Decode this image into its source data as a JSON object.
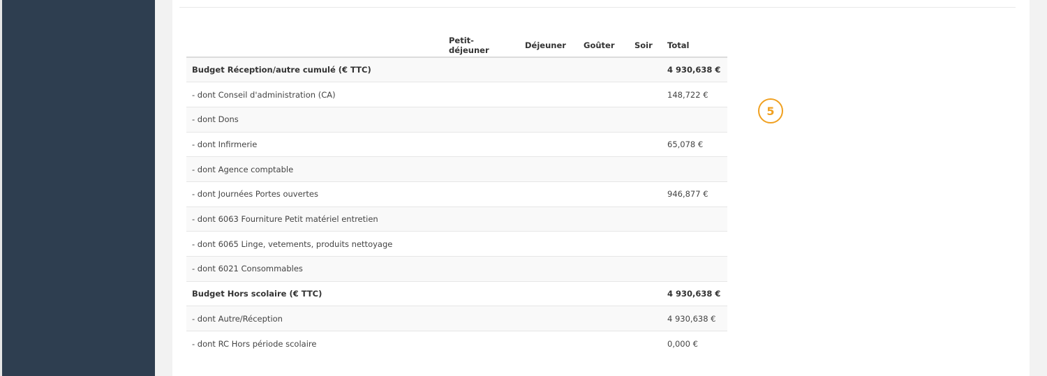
{
  "table": {
    "headers": {
      "label": "",
      "petit_dejeuner": "Petit-déjeuner",
      "dejeuner": "Déjeuner",
      "gouter": "Goûter",
      "soir": "Soir",
      "total": "Total"
    },
    "rows": [
      {
        "label": "Budget Réception/autre cumulé (€ TTC)",
        "total": "4 930,638 €",
        "bold": true
      },
      {
        "label": "- dont Conseil d'administration (CA)",
        "total": "148,722 €"
      },
      {
        "label": "- dont Dons",
        "total": ""
      },
      {
        "label": "- dont Infirmerie",
        "total": "65,078 €"
      },
      {
        "label": "- dont Agence comptable",
        "total": ""
      },
      {
        "label": "- dont Journées Portes ouvertes",
        "total": "946,877 €"
      },
      {
        "label": "- dont 6063 Fourniture Petit matériel entretien",
        "total": ""
      },
      {
        "label": "- dont 6065 Linge, vetements, produits nettoyage",
        "total": ""
      },
      {
        "label": "- dont 6021 Consommables",
        "total": ""
      },
      {
        "label": "Budget Hors scolaire (€ TTC)",
        "total": "4 930,638 €",
        "bold": true
      },
      {
        "label": "- dont Autre/Réception",
        "total": "4 930,638 €"
      },
      {
        "label": "- dont RC Hors période scolaire",
        "total": "0,000 €"
      }
    ]
  },
  "step_badge": "5",
  "colors": {
    "sidebar": "#2e3e50",
    "badge": "#f0a020"
  }
}
